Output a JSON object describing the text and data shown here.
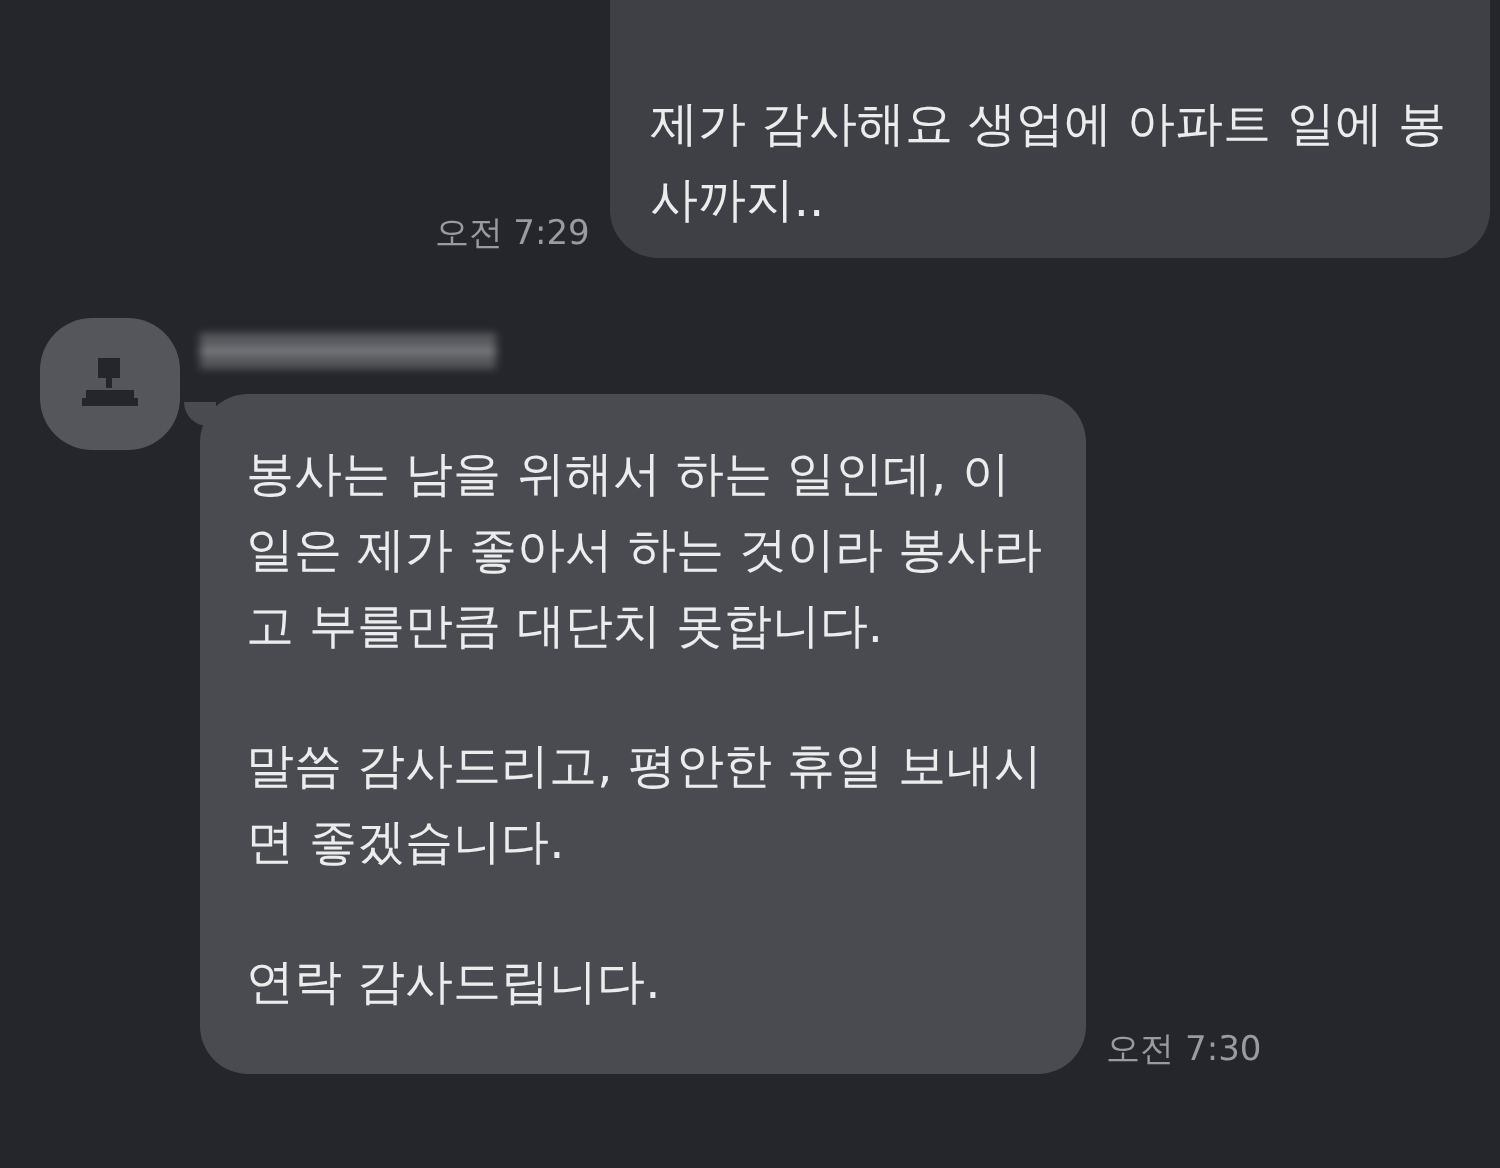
{
  "messages": [
    {
      "kind": "sent",
      "paragraphs": [
        "제가 감사해요 생업에 아파트 일에 봉\n사까지.."
      ],
      "time": "오전 7:29"
    },
    {
      "kind": "received",
      "paragraphs": [
        "봉사는 남을 위해서 하는 일인데, 이\n일은 제가 좋아서 하는 것이라 봉사라\n고 부를만큼 대단치 못합니다.",
        "말씀 감사드리고, 평안한 휴일 보내시\n면 좋겠습니다.",
        "연락 감사드립니다."
      ],
      "time": "오전 7:30"
    }
  ]
}
